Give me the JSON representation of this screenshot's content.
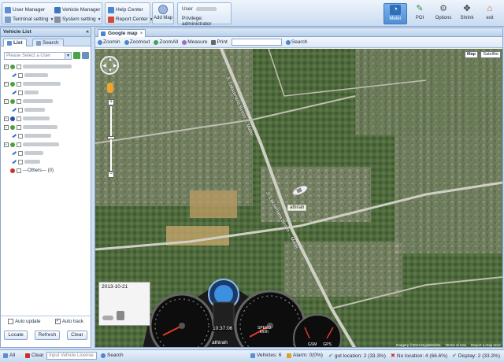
{
  "toolbar": {
    "user_manager": "User Manager",
    "terminal_setting": "Terminal setting",
    "vehicle_manager": "Vehicle Manager",
    "system_setting": "System setting",
    "help_center": "Help Center",
    "report_center": "Report Center",
    "add_map": "Add Map",
    "user_label": "User",
    "privilege_label": "Privilege: administrator",
    "right_buttons": [
      {
        "label": "Meter",
        "icon": "meter-icon"
      },
      {
        "label": "POI",
        "icon": "pin-icon"
      },
      {
        "label": "Options",
        "icon": "options-icon"
      },
      {
        "label": "Shrink",
        "icon": "shrink-icon"
      },
      {
        "label": "exit",
        "icon": "home-icon"
      }
    ]
  },
  "left_panel": {
    "title": "Vehicle List",
    "tabs": {
      "list": "List",
      "search": "Search"
    },
    "user_select_placeholder": "Please Select a User",
    "others_label": "---Others--- (0)",
    "auto_update": "Auto update",
    "auto_track": "Auto track",
    "buttons": {
      "locate": "Locate",
      "refresh": "Refresh",
      "clear": "Clear"
    }
  },
  "map_panel": {
    "tab_title": "Google map",
    "tools": [
      "Zoomin",
      "Zoomout",
      "ZoomAll",
      "Measure",
      "Print"
    ],
    "search_label": "Search",
    "map_types": [
      "Map",
      "Satellite"
    ],
    "vehicle_label": "athirah",
    "road_labels": [
      "Jl. Laksamana Bintan ... Malay",
      "Jl. Laksamana Bintan ... Malay"
    ],
    "attribution": [
      "Imagery ©2013 DigitalGlobe",
      "Terms of Use",
      "Report a map error"
    ],
    "dashboard": {
      "date": "2013-10-21",
      "time": "10:37:06",
      "name": "athirah",
      "speed_label": "SPEED",
      "speed_unit": "km/h",
      "gsm_label": "GSM",
      "gps_label": "GPS"
    }
  },
  "status_bar": {
    "all_label": "All",
    "clear_label": "Clear",
    "license_placeholder": "Input Vehicle License",
    "search_label": "Search",
    "vehicles": "Vehicles: 6",
    "alarm": "Alarm: 0(0%)",
    "got_location": "got location: 2 (33.3%)",
    "no_location": "No location: 4 (66.6%)",
    "display": "Display: 2 (33.3%)"
  },
  "colors": {
    "accent": "#4f8fd6",
    "panel_border": "#8aa7cc",
    "toolbar_bg": "#dae7f6"
  }
}
